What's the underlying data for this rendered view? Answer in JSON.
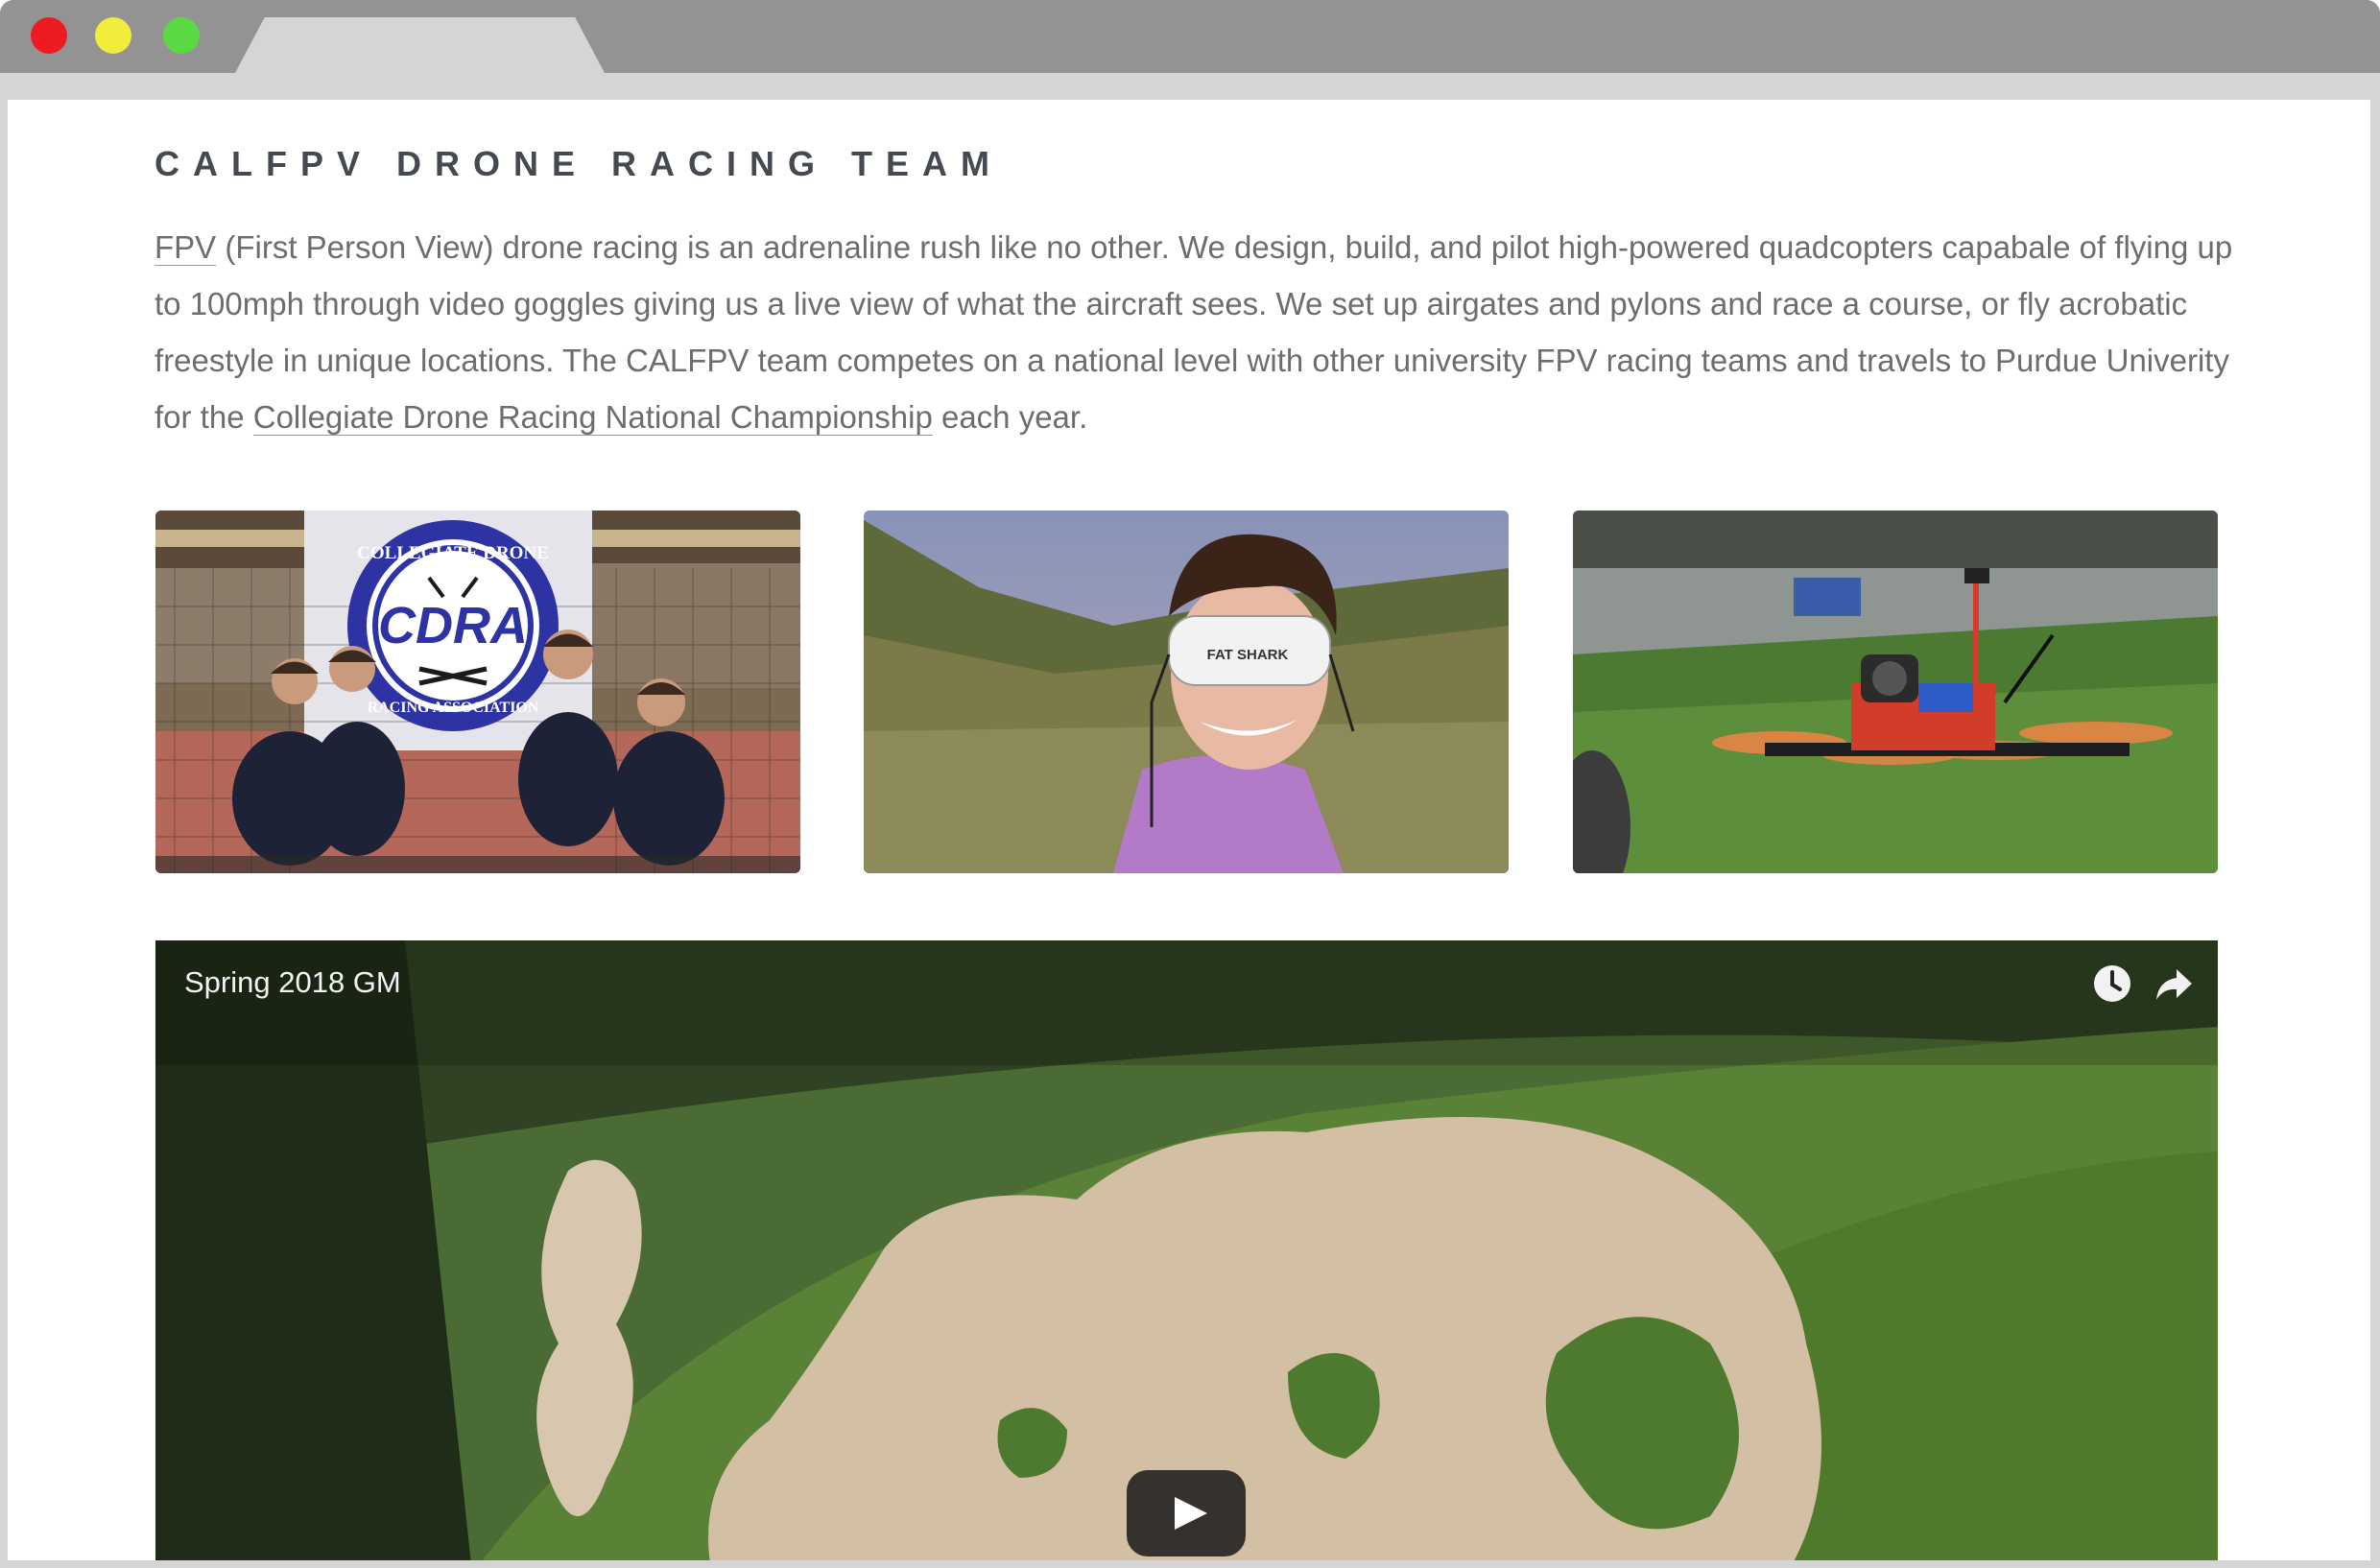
{
  "page": {
    "heading": "CALFPV DRONE RACING TEAM",
    "intro": {
      "link_fpv": "FPV",
      "text_1": " (First Person View) drone racing is an adrenaline rush like no other. We design, build, and pilot high-powered quadcopters capabale of flying up to 100mph through video goggles giving us a live view of what the aircraft sees. We set up airgates and pylons and race a course, or fly acrobatic freestyle in unique locations. The CALFPV team competes on a national level with other university FPV racing teams and travels to Purdue Univerity for the ",
      "link_championship": "Collegiate Drone Racing National Championship",
      "text_2": " each year."
    },
    "photos": [
      {
        "name": "team-photo",
        "badge_top": "COLLEGIATE DRONE",
        "badge_main": "CDRA",
        "badge_bottom": "RACING ASSOCIATION"
      },
      {
        "name": "pilot-photo",
        "goggles_label": "FAT SHARK"
      },
      {
        "name": "drone-photo"
      }
    ],
    "video": {
      "title": "Spring 2018 GM",
      "icons": [
        "clock-icon",
        "share-icon",
        "play-icon"
      ]
    }
  },
  "colors": {
    "heading": "#444a4f",
    "body_text": "#6d6d6d",
    "chrome": "#939393",
    "tab": "#d5d5d5"
  }
}
